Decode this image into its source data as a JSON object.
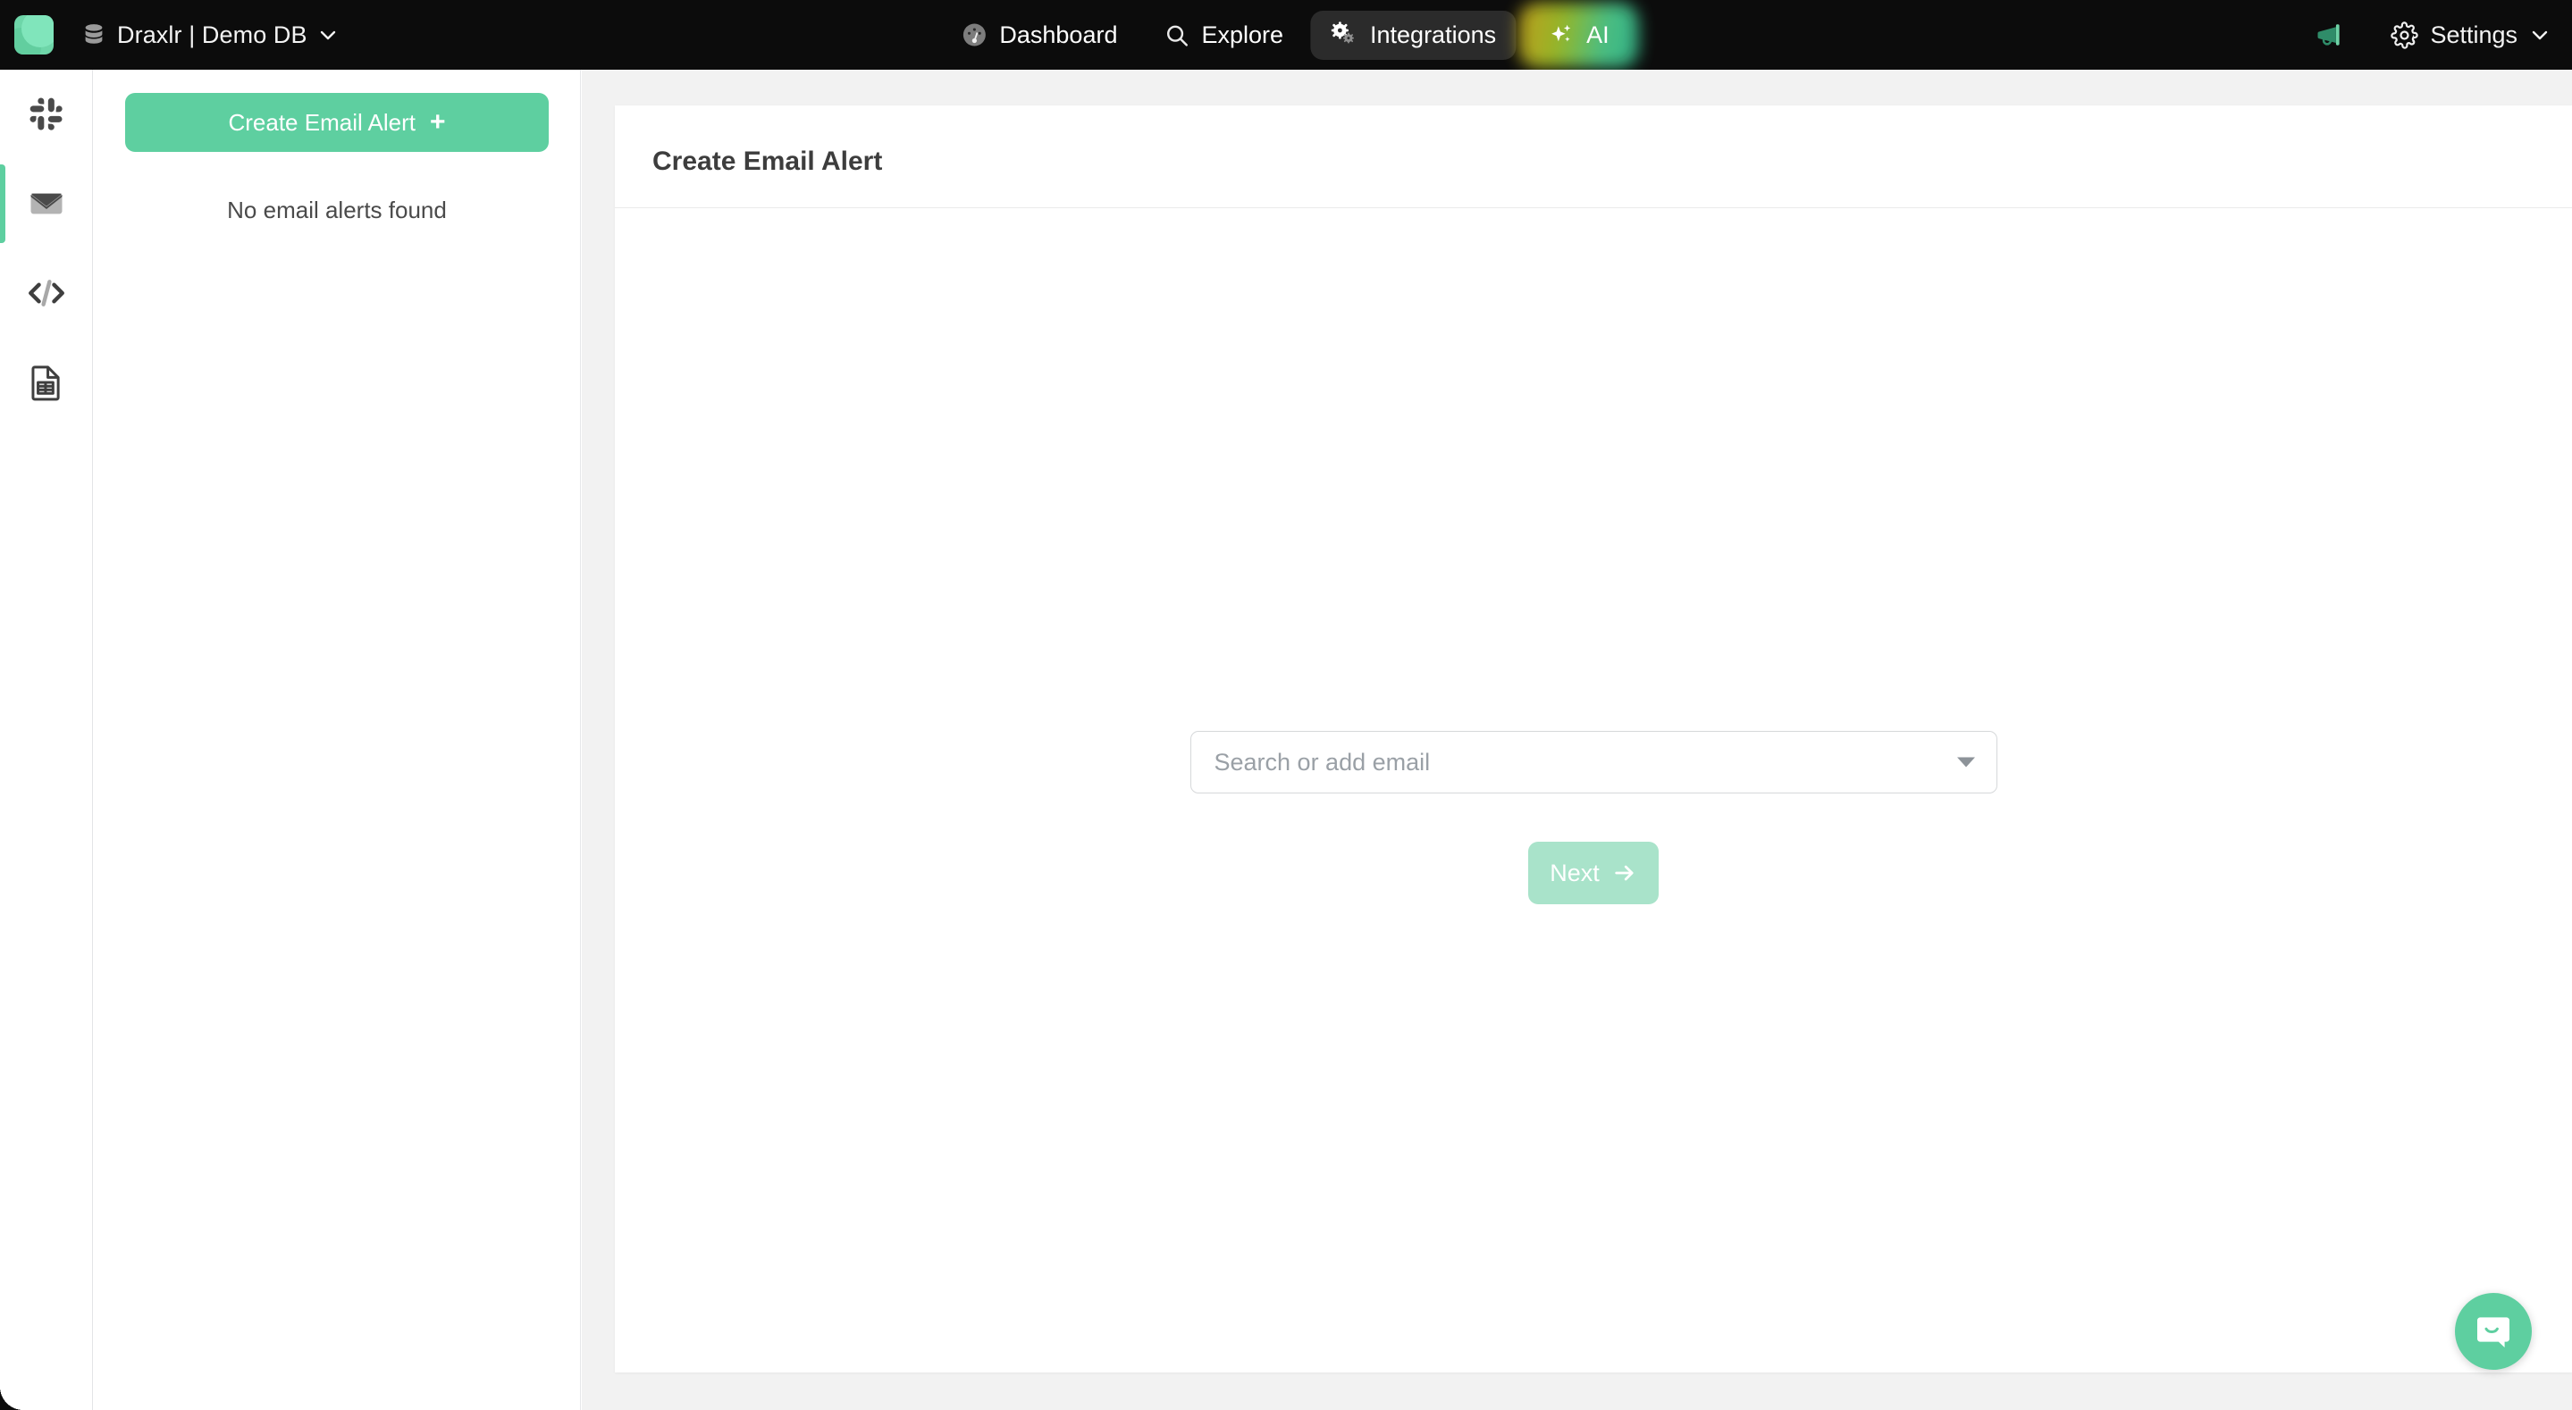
{
  "topbar": {
    "logo_icon": "draxlr-logo-icon",
    "logo_color": "#6ed6a9",
    "db_icon": "database-icon",
    "db_name": "Draxlr | Demo DB",
    "db_chevron_icon": "chevron-down-icon",
    "nav": [
      {
        "id": "dashboard",
        "label": "Dashboard",
        "icon": "gauge-icon",
        "active": false
      },
      {
        "id": "explore",
        "label": "Explore",
        "icon": "search-icon",
        "active": false
      },
      {
        "id": "integrations",
        "label": "Integrations",
        "icon": "gears-icon",
        "active": true
      },
      {
        "id": "ai",
        "label": "AI",
        "icon": "sparkle-icon",
        "active": false
      }
    ],
    "announce_icon": "megaphone-icon",
    "announce_color": "#4cba8e",
    "settings_icon": "gear-icon",
    "settings_label": "Settings",
    "settings_chevron_icon": "chevron-down-icon"
  },
  "icon_rail": {
    "items": [
      {
        "id": "slack",
        "icon": "slack-icon",
        "active": false
      },
      {
        "id": "email",
        "icon": "envelope-icon",
        "active": true
      },
      {
        "id": "webhook",
        "icon": "code-icon",
        "active": false
      },
      {
        "id": "spreadsheet",
        "icon": "spreadsheet-icon",
        "active": false
      }
    ],
    "active_indicator_color": "#5ecfa0"
  },
  "list_panel": {
    "create_button_label": "Create Email Alert",
    "create_button_icon": "plus-icon",
    "create_button_color": "#5ecfa0",
    "empty_message": "No email alerts found"
  },
  "main": {
    "card_title": "Create Email Alert",
    "email_field": {
      "placeholder": "Search or add email",
      "value": "",
      "caret_icon": "caret-down-icon"
    },
    "next_button": {
      "label": "Next",
      "icon": "arrow-right-icon",
      "disabled": true,
      "color": "#a9e3ca"
    }
  },
  "chat_widget": {
    "icon": "chat-bubble-smile-icon",
    "color": "#5ecfa0"
  }
}
